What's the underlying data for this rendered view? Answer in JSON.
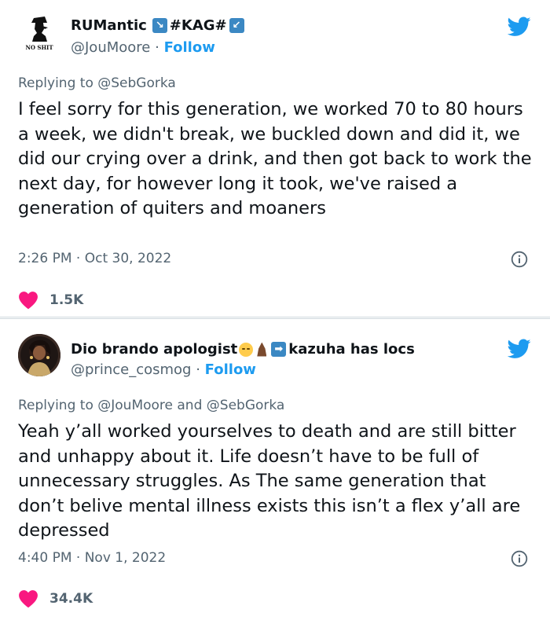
{
  "tweets": [
    {
      "display_name": "RUMantic",
      "name_suffix_text": "#KAG#",
      "handle": "@JouMoore",
      "separator": "·",
      "follow_label": "Follow",
      "avatar_caption": "NO SHIT",
      "replying_prefix": "Replying to",
      "replying_to": [
        "@SebGorka"
      ],
      "text": "I feel sorry for this generation, we worked 70 to 80 hours a week, we didn't break, we buckled down and did it, we did our crying over a drink, and then got back to work the next day, for however long it took, we've raised a generation of quiters and moaners",
      "time": "2:26 PM",
      "date": "Oct 30, 2022",
      "likes": "1.5K"
    },
    {
      "display_name": "Dio brando apologist",
      "name_suffix_text": "kazuha has locs",
      "handle": "@prince_cosmog",
      "separator": "·",
      "follow_label": "Follow",
      "replying_prefix": "Replying to",
      "replying_to": [
        "@JouMoore",
        "and",
        "@SebGorka"
      ],
      "text": "Yeah y’all worked yourselves to death and are still bitter and unhappy about it. Life doesn’t have to be full of unnecessary struggles. As The same generation that don’t belive mental illness exists this isn’t a flex y’all are depressed",
      "time": "4:40 PM",
      "date": "Nov 1, 2022",
      "likes": "34.4K"
    }
  ],
  "colors": {
    "text": "#0f1419",
    "secondary": "#536471",
    "twitter_blue": "#1d9bf0",
    "heart": "#f91880",
    "divider": "#cfd9de"
  },
  "icons": {
    "brand": "twitter-bird-icon",
    "info": "info-icon",
    "like": "heart-icon",
    "arrow_down_right": "arrow-down-right-icon",
    "arrow_down_left": "arrow-down-left-icon",
    "arrow_right": "arrow-right-icon",
    "pensive_face": "pensive-face-emoji-icon",
    "praying_hands": "praying-hands-emoji-icon"
  }
}
